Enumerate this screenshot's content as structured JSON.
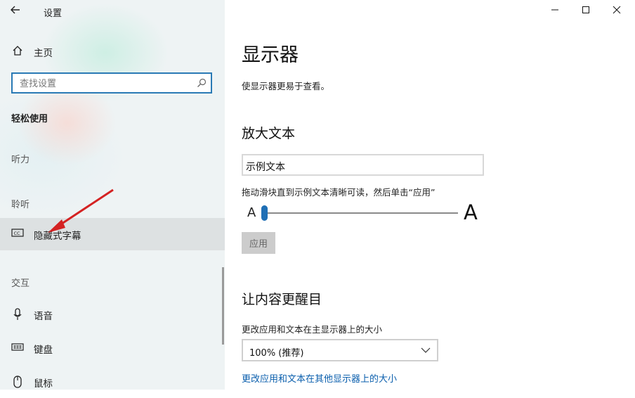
{
  "window": {
    "app_title": "设置",
    "controls": {
      "minimize": "—",
      "maximize": "☐",
      "close": "✕"
    }
  },
  "sidebar": {
    "home_label": "主页",
    "search": {
      "placeholder": "查找设置",
      "value": ""
    },
    "section_title": "轻松使用",
    "groups": {
      "hearing": "听力",
      "hearing2": "聆听",
      "interaction": "交互"
    },
    "items": {
      "captions": "隐藏式字幕",
      "speech": "语音",
      "keyboard": "键盘",
      "mouse": "鼠标"
    }
  },
  "main": {
    "title": "显示器",
    "description": "使显示器更易于查看。",
    "text_size": {
      "heading": "放大文本",
      "sample_text": "示例文本",
      "hint": "拖动滑块直到示例文本清晰可读，然后单击“应用”",
      "small_a": "A",
      "large_a": "A",
      "slider_value_fraction": 0.0,
      "apply_label": "应用"
    },
    "make_bigger": {
      "heading": "让内容更醒目",
      "scale_label": "更改应用和文本在主显示器上的大小",
      "scale_value": "100% (推荐)",
      "other_link": "更改应用和文本在其他显示器上的大小"
    }
  },
  "colors": {
    "accent": "#1f6fb5",
    "link": "#0b5fad",
    "annotation_arrow": "#d42222"
  }
}
